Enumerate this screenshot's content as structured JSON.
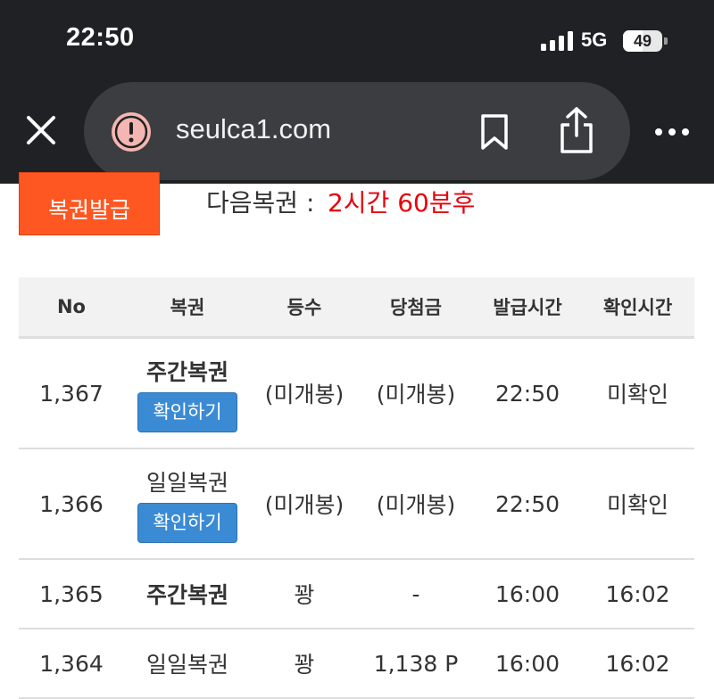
{
  "status_bar": {
    "time": "22:50",
    "network": "5G",
    "battery": "49"
  },
  "browser": {
    "url": "seulca1.com"
  },
  "page": {
    "issue_button": "복권발급",
    "next_label": "다음복권 : ",
    "next_time": "2시간 60분후"
  },
  "table": {
    "headers": [
      "No",
      "복권",
      "등수",
      "당첨금",
      "발급시간",
      "확인시간"
    ],
    "rows": [
      {
        "no": "1,367",
        "ticket": "주간복권",
        "button": "확인하기",
        "rank": "(미개봉)",
        "prize": "(미개봉)",
        "issued": "22:50",
        "checked": "미확인"
      },
      {
        "no": "1,366",
        "ticket": "일일복권",
        "button": "확인하기",
        "rank": "(미개봉)",
        "prize": "(미개봉)",
        "issued": "22:50",
        "checked": "미확인"
      },
      {
        "no": "1,365",
        "ticket": "주간복권",
        "rank": "꽝",
        "prize": "-",
        "issued": "16:00",
        "checked": "16:02"
      },
      {
        "no": "1,364",
        "ticket": "일일복권",
        "rank": "꽝",
        "prize": "1,138 P",
        "issued": "16:00",
        "checked": "16:02"
      }
    ]
  },
  "colors": {
    "issue_button": "#ff5722",
    "next_time": "#e8000b",
    "check_button": "#3b8bd4",
    "unconfirmed": "#f0a500",
    "chrome": "#202124"
  },
  "icons": [
    "signal-icon",
    "battery-icon",
    "close-icon",
    "warning-icon",
    "bookmark-icon",
    "share-icon",
    "more-icon"
  ]
}
